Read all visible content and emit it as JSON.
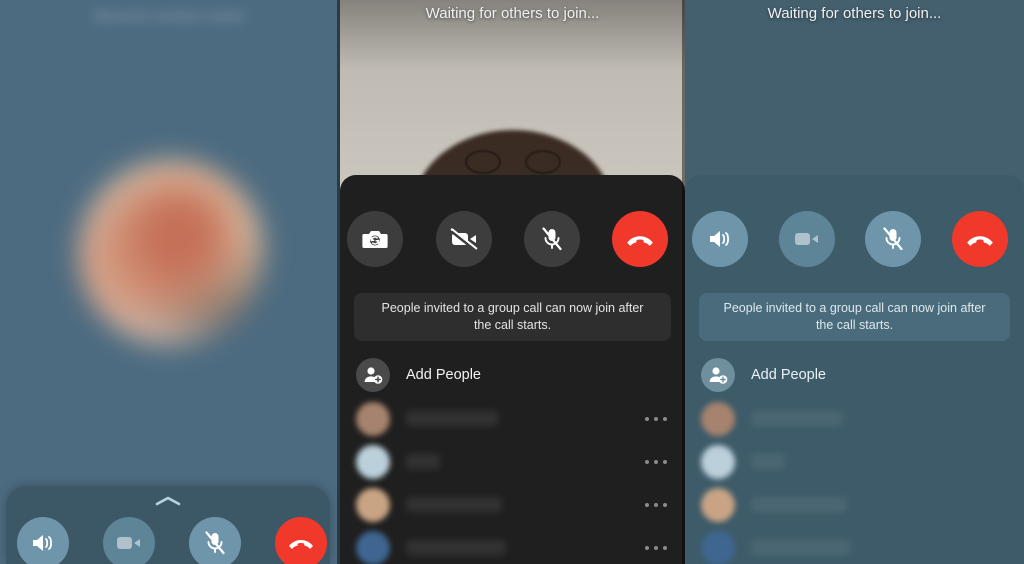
{
  "app": {
    "name": "group-video-call",
    "colors": {
      "accent_blue": "#6f95aa",
      "end_call_red": "#f0392b",
      "panel_blue": "#4d6b80",
      "sheet_dark": "#1f1f1f",
      "sheet_blue": "#3e5b69"
    }
  },
  "panels": {
    "left": {
      "blurred_title": "Blurred contact name",
      "avatar_alt": "blurred-profile-photo",
      "sheet": {
        "handle": "chevron-up",
        "controls": [
          {
            "name": "speaker-button",
            "icon": "speaker-icon",
            "state": "on"
          },
          {
            "name": "video-button",
            "icon": "video-camera-icon",
            "state": "disabled"
          },
          {
            "name": "mic-button",
            "icon": "microphone-muted-icon",
            "state": "muted"
          },
          {
            "name": "end-call-button",
            "icon": "end-call-icon",
            "state": "active"
          }
        ]
      }
    },
    "center": {
      "status": "Waiting for others to join...",
      "video_alt": "self-view-camera-preview",
      "sheet": {
        "controls": [
          {
            "name": "flip-camera-button",
            "icon": "camera-flip-icon",
            "state": "on"
          },
          {
            "name": "video-button",
            "icon": "video-camera-off-icon",
            "state": "off"
          },
          {
            "name": "mic-button",
            "icon": "microphone-muted-icon",
            "state": "muted"
          },
          {
            "name": "end-call-button",
            "icon": "end-call-icon",
            "state": "active"
          }
        ],
        "banner": "People invited to a group call can now join after the call starts.",
        "add_people": {
          "label": "Add People",
          "icon": "person-add-icon"
        },
        "contacts": [
          {
            "name_blurred": "Contact name 1",
            "name_width": 92,
            "avatar": "#a6836e",
            "menu": "more-options-icon"
          },
          {
            "name_blurred": "Contact name 2",
            "name_width": 34,
            "avatar": "#bcd0db",
            "menu": "more-options-icon"
          },
          {
            "name_blurred": "Contact name 3",
            "name_width": 96,
            "avatar": "#c9a484",
            "menu": "more-options-icon"
          },
          {
            "name_blurred": "Contact name 4",
            "name_width": 100,
            "avatar": "#3e6690",
            "menu": "more-options-icon"
          }
        ]
      }
    },
    "right": {
      "status": "Waiting for others to join...",
      "sheet": {
        "controls": [
          {
            "name": "speaker-button",
            "icon": "speaker-icon",
            "state": "on"
          },
          {
            "name": "video-button",
            "icon": "video-camera-icon",
            "state": "disabled"
          },
          {
            "name": "mic-button",
            "icon": "microphone-muted-icon",
            "state": "muted"
          },
          {
            "name": "end-call-button",
            "icon": "end-call-icon",
            "state": "active"
          }
        ],
        "banner": "People invited to a group call can now join after the call starts.",
        "add_people": {
          "label": "Add People",
          "icon": "person-add-icon"
        },
        "contacts": [
          {
            "name_blurred": "Contact name 1",
            "name_width": 92,
            "avatar": "#a6836e"
          },
          {
            "name_blurred": "Contact name 2",
            "name_width": 34,
            "avatar": "#bcd0db"
          },
          {
            "name_blurred": "Contact name 3",
            "name_width": 96,
            "avatar": "#c9a484"
          },
          {
            "name_blurred": "Contact name 4",
            "name_width": 100,
            "avatar": "#3e6690"
          }
        ]
      }
    }
  }
}
